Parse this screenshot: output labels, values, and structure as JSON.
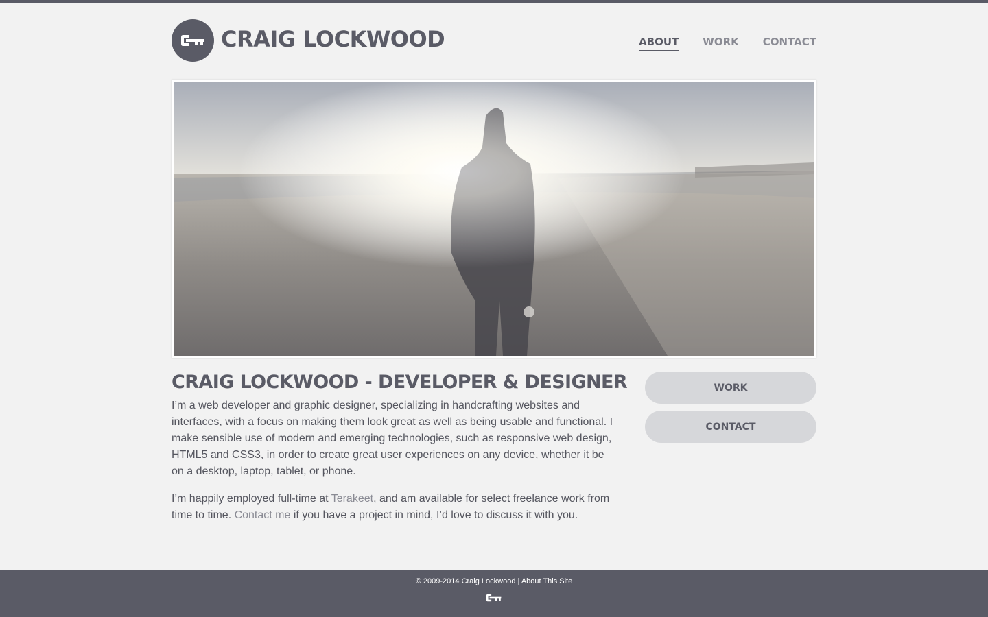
{
  "site": {
    "name": "CRAIG LOCKWOOD",
    "logo_icon": "key-icon"
  },
  "nav": {
    "items": [
      {
        "label": "ABOUT",
        "active": true
      },
      {
        "label": "WORK",
        "active": false
      },
      {
        "label": "CONTACT",
        "active": false
      }
    ]
  },
  "hero": {
    "image": "sunset-beach-portrait-photo"
  },
  "main": {
    "heading": "CRAIG LOCKWOOD - DEVELOPER & DESIGNER",
    "p1": "I’m a web developer and graphic designer, specializing in handcrafting websites and interfaces, with a focus on making them look great as well as being usable and functional. I make sensible use of modern and emerging technologies, such as responsive web design, HTML5 and CSS3, in order to create great user experiences on any device, whether it be on a desktop, laptop, tablet, or phone.",
    "p2_before": "I’m happily employed full-time at ",
    "p2_link1": "Terakeet",
    "p2_middle": ", and am available for select freelance work from time to time. ",
    "p2_link2": "Contact me",
    "p2_after": " if you have a project in mind, I’d love to discuss it with you."
  },
  "sidebar": {
    "work_label": "WORK",
    "contact_label": "CONTACT"
  },
  "footer": {
    "copyright": "© 2009-2014 Craig Lockwood",
    "separator": " | ",
    "about_link": "About This Site",
    "icon": "key-icon"
  },
  "colors": {
    "background": "#f2f2f2",
    "primary": "#5a5b66",
    "muted": "#8a8b94",
    "pill": "#d6d7da"
  }
}
